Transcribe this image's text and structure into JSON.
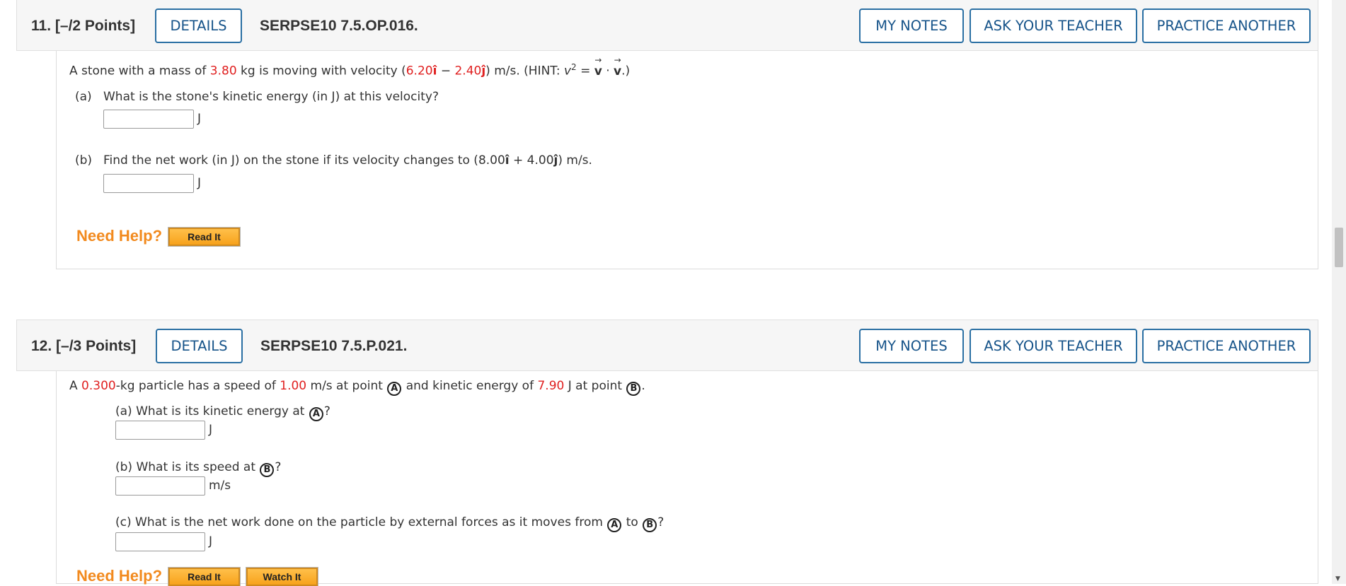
{
  "questions": [
    {
      "number": "11.",
      "points": "[–/2 Points]",
      "details_label": "DETAILS",
      "code": "SERPSE10 7.5.OP.016.",
      "my_notes_label": "MY NOTES",
      "ask_teacher_label": "ASK YOUR TEACHER",
      "practice_label": "PRACTICE ANOTHER",
      "stem": {
        "t1": "A stone with a mass of ",
        "mass": "3.80",
        "t2": " kg is moving with velocity (",
        "vx": "6.20",
        "i_hat": "î",
        "minus": " − ",
        "vy": "2.40",
        "j_hat": "ĵ",
        "t3": ") m/s. (HINT: ",
        "v_sym": "v",
        "exp": "2",
        "t4": " = ",
        "vec_v": "v",
        "dot": " · ",
        "arrow": "→",
        "t5": ".)"
      },
      "part_a": {
        "label": "(a)",
        "text": "What is the stone's kinetic energy (in J) at this velocity?",
        "unit": "J"
      },
      "part_b": {
        "label": "(b)",
        "text_pre": "Find the net work (in J) on the stone if its velocity changes to (8.00",
        "i_hat": "î",
        "plus": " + 4.00",
        "j_hat": "ĵ",
        "text_post": ") m/s.",
        "unit": "J"
      },
      "need_help": "Need Help?",
      "read_it": "Read It"
    },
    {
      "number": "12.",
      "points": "[–/3 Points]",
      "details_label": "DETAILS",
      "code": "SERPSE10 7.5.P.021.",
      "my_notes_label": "MY NOTES",
      "ask_teacher_label": "ASK YOUR TEACHER",
      "practice_label": "PRACTICE ANOTHER",
      "stem": {
        "t1": "A ",
        "mass": "0.300",
        "t2": "-kg particle has a speed of ",
        "speed": "1.00",
        "t3": " m/s at point ",
        "pt_a": "A",
        "t4": " and kinetic energy of ",
        "ke": "7.90",
        "t5": " J at point ",
        "pt_b": "B",
        "t6": "."
      },
      "part_a": {
        "text": "(a) What is its kinetic energy at ",
        "pt": "A",
        "q": "?",
        "unit": "J"
      },
      "part_b": {
        "text": "(b) What is its speed at ",
        "pt": "B",
        "q": "?",
        "unit": "m/s"
      },
      "part_c": {
        "text": "(c) What is the net work done on the particle by external forces as it moves from ",
        "pt_a": "A",
        "to": " to ",
        "pt_b": "B",
        "q": "?",
        "unit": "J"
      },
      "need_help": "Need Help?",
      "read_it": "Read It",
      "watch_it": "Watch It"
    }
  ],
  "colors": {
    "accent_blue": "#17548a",
    "value_red": "#e02020",
    "help_orange": "#f28a1e"
  }
}
